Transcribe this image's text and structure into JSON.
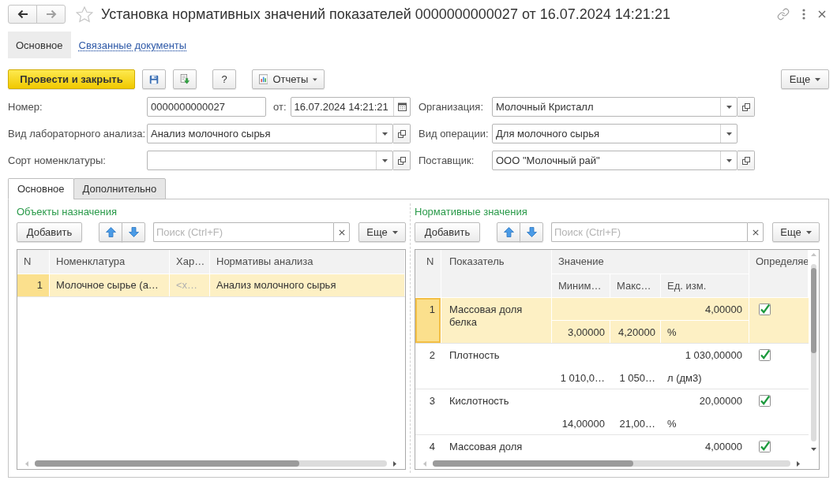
{
  "window": {
    "title": "Установка нормативных значений показателей 0000000000027 от 16.07.2024 14:21:21"
  },
  "sections": [
    {
      "label": "Основное",
      "selected": true
    },
    {
      "label": "Связанные документы",
      "selected": false
    }
  ],
  "toolbar": {
    "buttons": [
      {
        "kind": "primary",
        "label": "Провести и закрыть"
      },
      {
        "kind": "save"
      },
      {
        "kind": "post"
      },
      {
        "kind": "help",
        "label": "?"
      },
      {
        "kind": "menu",
        "label": "Отчеты"
      }
    ],
    "more": "Еще"
  },
  "form": {
    "left": [
      {
        "kind": "number",
        "label": "Номер:",
        "value": "0000000000027",
        "date": {
          "label": "от:",
          "value": "16.07.2024 14:21:21"
        }
      },
      {
        "kind": "select",
        "label": "Вид лабораторного анализа:",
        "value": "Анализ молочного сырья",
        "open_button": true
      },
      {
        "kind": "select",
        "label": "Сорт номенклатуры:",
        "open_button": true
      }
    ],
    "right": [
      {
        "kind": "select",
        "label": "Организация:",
        "value": "Молочный Кристалл",
        "open_button": true
      },
      {
        "kind": "select",
        "label": "Вид операции:",
        "value": "Для молочного сырья",
        "open_button": false
      },
      {
        "kind": "select",
        "label": "Поставщик:",
        "value": "ООО \"Молочный рай\"",
        "open_button": true
      }
    ]
  },
  "tabs": [
    {
      "label": "Основное",
      "selected": true
    },
    {
      "label": "Дополнительно",
      "selected": false
    }
  ],
  "objects": {
    "title": "Объекты назначения",
    "add": "Добавить",
    "search": {
      "placeholder": "Поиск (Ctrl+F)"
    },
    "more": "Еще",
    "columns": [
      "N",
      "Номенклатура",
      "Хар…",
      "Нормативы анализа"
    ],
    "rows": [
      {
        "selected": true,
        "cells": [
          {
            "text": "1",
            "muted": false
          },
          {
            "text": "Молочное сырье (а…",
            "muted": false
          },
          {
            "text": "<х…",
            "muted": true
          },
          {
            "text": "Анализ молочного сырья",
            "muted": false
          }
        ]
      }
    ]
  },
  "norms": {
    "title": "Нормативные значения",
    "add": "Добавить",
    "search": {
      "placeholder": "Поиск (Ctrl+F)"
    },
    "more": "Еще",
    "columns": {
      "n": "N",
      "indicator": "Показатель",
      "value": "Значение",
      "min": "Миним…",
      "max": "Макс…",
      "unit": "Ед. изм.",
      "determined": "Определяе"
    },
    "rows": [
      {
        "n": "1",
        "indicator": "Массовая доля белка",
        "value": "4,00000",
        "min": "3,00000",
        "max": "4,20000",
        "unit": "%",
        "determined": true,
        "selected": true,
        "focused": true
      },
      {
        "n": "2",
        "indicator": "Плотность",
        "value": "1 030,00000",
        "min": "1 010,0…",
        "max": "1 050…",
        "unit": "л (дм3)",
        "determined": true,
        "selected": false,
        "focused": false
      },
      {
        "n": "3",
        "indicator": "Кислотность",
        "value": "20,00000",
        "min": "14,00000",
        "max": "21,00…",
        "unit": "%",
        "determined": true,
        "selected": false,
        "focused": false
      },
      {
        "n": "4",
        "indicator": "Массовая доля",
        "value": "4,00000",
        "determined": true,
        "selected": false,
        "focused": false
      }
    ]
  }
}
